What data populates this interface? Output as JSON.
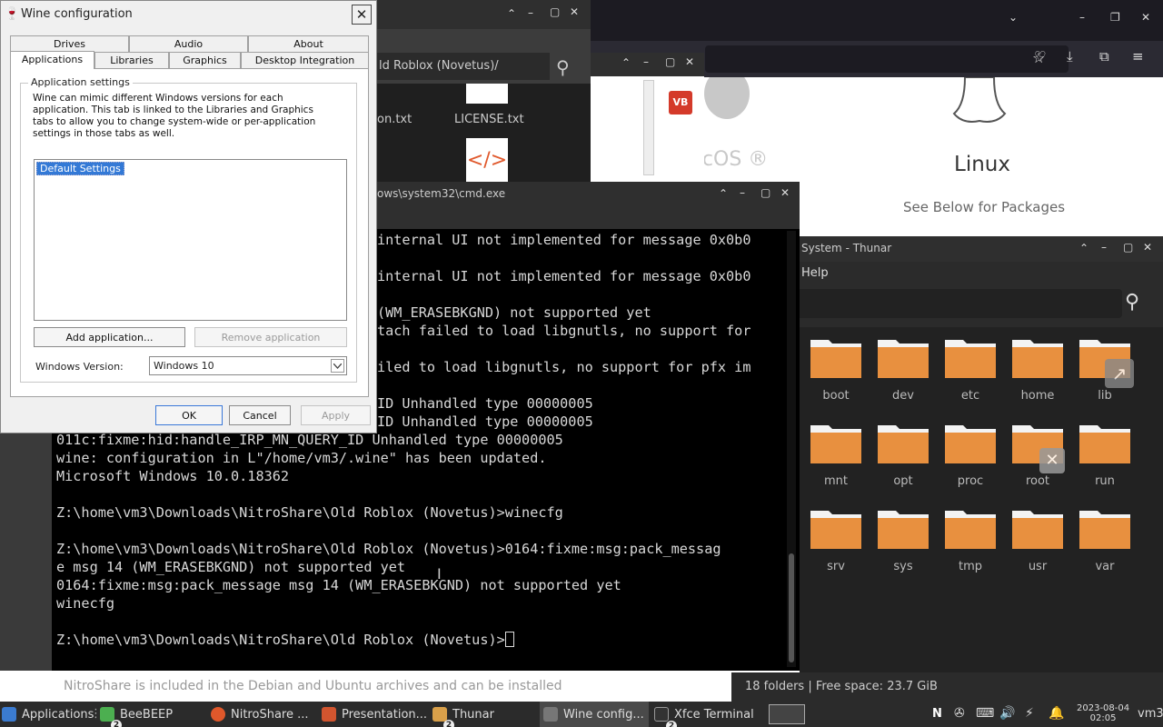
{
  "browser": {
    "macos_label": "macOS ®",
    "linux_label": "Linux",
    "linux_sub": "See Below for Packages",
    "footer_text": "NitroShare is included in the Debian and Ubuntu archives and can be installed"
  },
  "files_window": {
    "path": "ld Roblox (Novetus)/",
    "file1": "on.txt",
    "file2": "LICENSE.txt"
  },
  "vb_window": {
    "badge": "VB"
  },
  "thunar": {
    "title": "System - Thunar",
    "menu_help": "Help",
    "folders": [
      "boot",
      "dev",
      "etc",
      "home",
      "lib",
      "mnt",
      "opt",
      "proc",
      "root",
      "run",
      "srv",
      "sys",
      "tmp",
      "usr",
      "var"
    ],
    "status": "18 folders  |  Free space: 23.7 GiB"
  },
  "cmd": {
    "title": "ows\\system32\\cmd.exe",
    "lines": [
      "internal UI not implemented for message 0x0b0",
      "",
      "internal UI not implemented for message 0x0b0",
      "",
      "(WM_ERASEBKGND) not supported yet",
      "tach failed to load libgnutls, no support for",
      "",
      "iled to load libgnutls, no support for pfx im",
      "",
      "ID Unhandled type 00000005",
      "ID Unhandled type 00000005",
      "011c:fixme:hid:handle_IRP_MN_QUERY_ID Unhandled type 00000005",
      "wine: configuration in L\"/home/vm3/.wine\" has been updated.",
      "Microsoft Windows 10.0.18362",
      "",
      "Z:\\home\\vm3\\Downloads\\NitroShare\\Old Roblox (Novetus)>winecfg",
      "",
      "Z:\\home\\vm3\\Downloads\\NitroShare\\Old Roblox (Novetus)>0164:fixme:msg:pack_messag",
      "e msg 14 (WM_ERASEBKGND) not supported yet",
      "0164:fixme:msg:pack_message msg 14 (WM_ERASEBKGND) not supported yet",
      "winecfg",
      "",
      "Z:\\home\\vm3\\Downloads\\NitroShare\\Old Roblox (Novetus)>"
    ]
  },
  "wine": {
    "title": "Wine configuration",
    "tabs_row1": [
      "Drives",
      "Audio",
      "About"
    ],
    "tabs_row2": [
      "Applications",
      "Libraries",
      "Graphics",
      "Desktop Integration"
    ],
    "group_label": "Application settings",
    "info": "Wine can mimic different Windows versions for each application. This tab is linked to the Libraries and Graphics tabs to allow you to change system-wide or per-application settings in those tabs as well.",
    "list_item": "Default Settings",
    "add_button": "Add application...",
    "remove_button": "Remove application",
    "version_label": "Windows Version:",
    "version_value": "Windows 10",
    "ok": "OK",
    "cancel": "Cancel",
    "apply": "Apply"
  },
  "taskbar": {
    "applications": "Applications",
    "items": [
      "BeeBEEP",
      "NitroShare ...",
      "Presentation...",
      "Thunar",
      "Wine config...",
      "Xfce Terminal"
    ],
    "badges": [
      "2",
      "2",
      "2"
    ],
    "date": "2023-08-04",
    "time": "02:05",
    "user": "vm3"
  },
  "colors": {
    "folder": "#e8903f",
    "selection": "#3379d6",
    "taskbar": "#2b2b2b"
  }
}
